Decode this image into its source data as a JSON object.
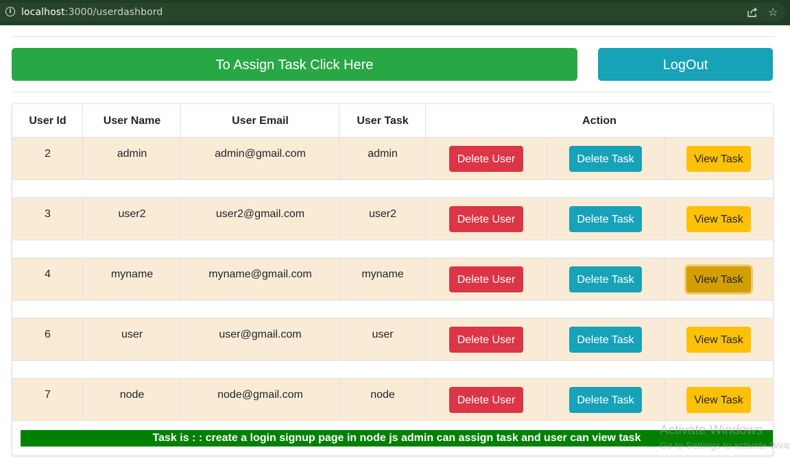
{
  "browser": {
    "url_host": "localhost",
    "url_path": ":3000/userdashbord"
  },
  "header": {
    "assign_label": "To Assign Task Click Here",
    "logout_label": "LogOut"
  },
  "table": {
    "columns": [
      "User Id",
      "User Name",
      "User Email",
      "User Task",
      "Action"
    ],
    "rows": [
      {
        "id": "2",
        "name": "admin",
        "email": "admin@gmail.com",
        "task": "admin"
      },
      {
        "id": "3",
        "name": "user2",
        "email": "user2@gmail.com",
        "task": "user2"
      },
      {
        "id": "4",
        "name": "myname",
        "email": "myname@gmail.com",
        "task": "myname"
      },
      {
        "id": "6",
        "name": "user",
        "email": "user@gmail.com",
        "task": "user"
      },
      {
        "id": "7",
        "name": "node",
        "email": "node@gmail.com",
        "task": "node"
      }
    ],
    "actions": {
      "delete_user": "Delete User",
      "delete_task": "Delete Task",
      "view_task": "View Task"
    }
  },
  "task_banner": "Task is : : create a login signup page in node js admin can assign task and user can view task",
  "watermark": {
    "title": "Activate Windows",
    "subtitle": "Go to Settings to activate Windows."
  },
  "colors": {
    "success": "#28a745",
    "info": "#17a2b8",
    "danger": "#dc3545",
    "warning": "#ffc107",
    "row_bg": "#faebd7",
    "banner": "#008000"
  }
}
